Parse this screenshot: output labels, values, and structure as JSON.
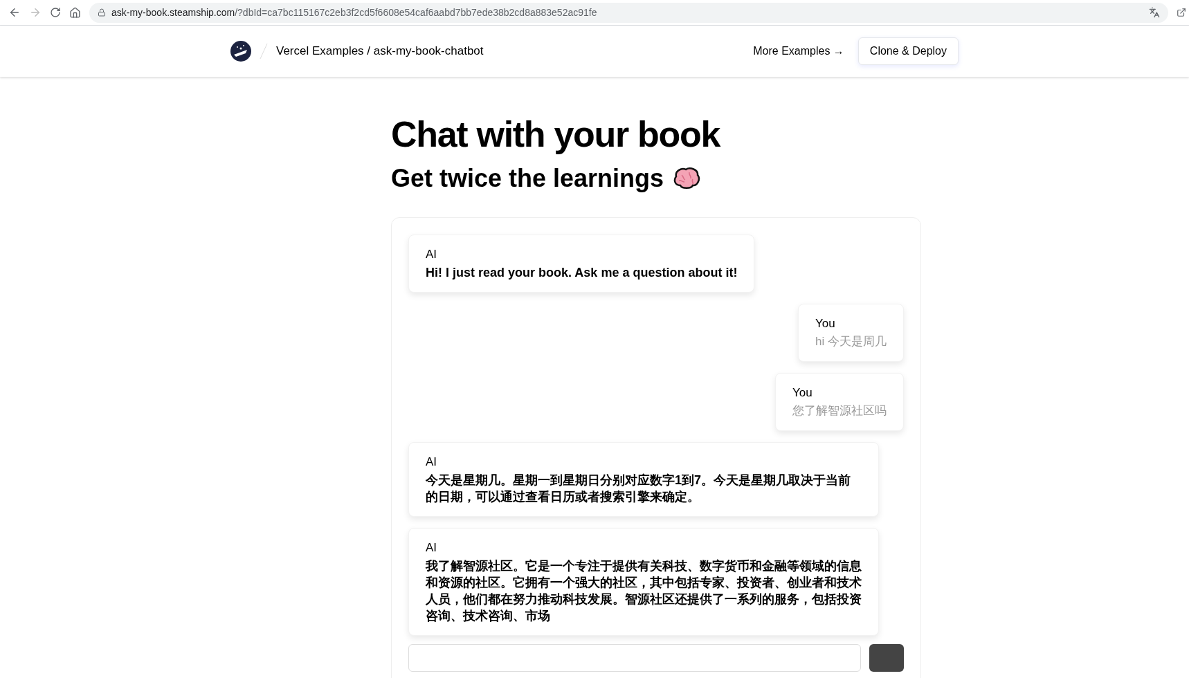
{
  "browser": {
    "url_host": "ask-my-book.steamship.com",
    "url_path": "/?dbId=ca7bc115167c2eb3f2cd5f6608e54caf6aabd7bb7ede38b2cd8a883e52ac91fe"
  },
  "header": {
    "breadcrumb": "Vercel Examples / ask-my-book-chatbot",
    "more_link": "More Examples →",
    "deploy_button": "Clone & Deploy"
  },
  "hero": {
    "title": "Chat with your book",
    "subtitle": "Get twice the learnings"
  },
  "messages": [
    {
      "sender": "AI",
      "kind": "ai",
      "text": "Hi! I just read your book. Ask me a question about it!"
    },
    {
      "sender": "You",
      "kind": "user",
      "text": "hi 今天是周几"
    },
    {
      "sender": "You",
      "kind": "user",
      "text": "您了解智源社区吗"
    },
    {
      "sender": "AI",
      "kind": "ai",
      "text": "今天是星期几。星期一到星期日分别对应数字1到7。今天是星期几取决于当前的日期，可以通过查看日历或者搜索引擎来确定。"
    },
    {
      "sender": "AI",
      "kind": "ai",
      "text": "我了解智源社区。它是一个专注于提供有关科技、数字货币和金融等领域的信息和资源的社区。它拥有一个强大的社区，其中包括专家、投资者、创业者和技术人员，他们都在努力推动科技发展。智源社区还提供了一系列的服务，包括投资咨询、技术咨询、市场"
    }
  ]
}
